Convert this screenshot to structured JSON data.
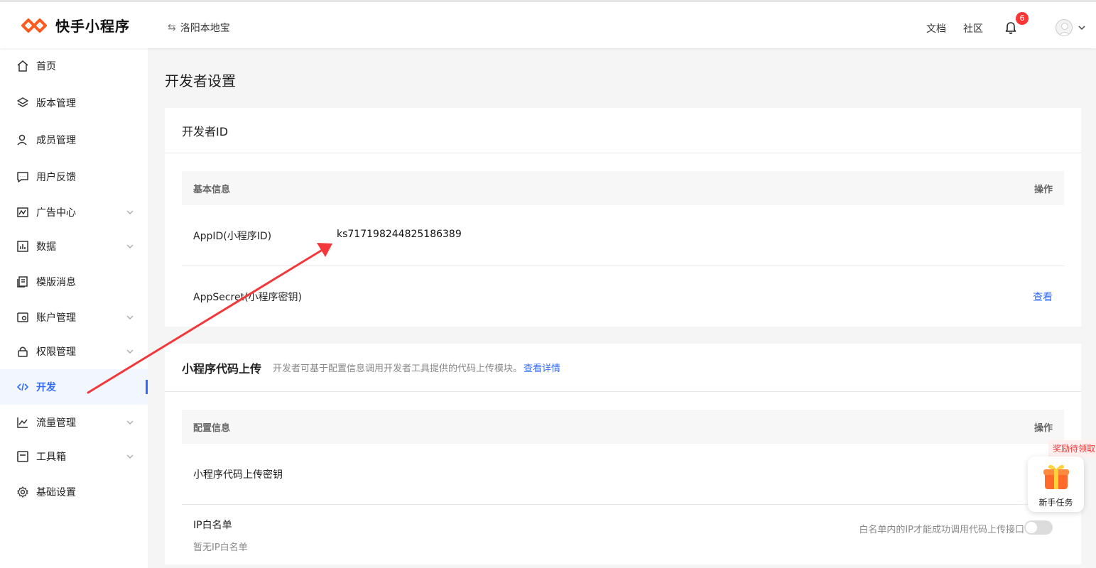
{
  "header": {
    "logo_text": "快手小程序",
    "app_name": "洛阳本地宝",
    "links": [
      "文档",
      "社区"
    ],
    "notification_count": "6"
  },
  "sidebar": {
    "items": [
      {
        "label": "首页",
        "icon": "home-icon",
        "has_chevron": false
      },
      {
        "label": "版本管理",
        "icon": "layers-icon",
        "has_chevron": false
      },
      {
        "label": "成员管理",
        "icon": "user-icon",
        "has_chevron": false
      },
      {
        "label": "用户反馈",
        "icon": "feedback-icon",
        "has_chevron": false
      },
      {
        "label": "广告中心",
        "icon": "ad-icon",
        "has_chevron": true
      },
      {
        "label": "数据",
        "icon": "chart-icon",
        "has_chevron": true
      },
      {
        "label": "模版消息",
        "icon": "template-icon",
        "has_chevron": false
      },
      {
        "label": "账户管理",
        "icon": "account-icon",
        "has_chevron": true
      },
      {
        "label": "权限管理",
        "icon": "lock-icon",
        "has_chevron": true
      },
      {
        "label": "开发",
        "icon": "code-icon",
        "has_chevron": false,
        "active": true
      },
      {
        "label": "流量管理",
        "icon": "trend-icon",
        "has_chevron": true
      },
      {
        "label": "工具箱",
        "icon": "toolbox-icon",
        "has_chevron": true
      },
      {
        "label": "基础设置",
        "icon": "gear-icon",
        "has_chevron": false
      }
    ]
  },
  "main": {
    "page_title": "开发者设置",
    "developer_id": {
      "title": "开发者ID",
      "header_left": "基本信息",
      "header_right": "操作",
      "rows": [
        {
          "label": "AppID(小程序ID)",
          "value": "ks717198244825186389"
        },
        {
          "label": "AppSecret(小程序密钥)",
          "action": "查看"
        }
      ]
    },
    "upload": {
      "title": "小程序代码上传",
      "desc": "开发者可基于配置信息调用开发者工具提供的代码上传模块。",
      "desc_link": "查看详情",
      "header_left": "配置信息",
      "header_right": "操作",
      "key_label": "小程序代码上传密钥",
      "whitelist_label": "IP白名单",
      "whitelist_empty": "暂无IP白名单",
      "whitelist_note": "白名单内的IP才能成功调用代码上传接口",
      "whitelist_enabled": false
    }
  },
  "reward": {
    "tag": "奖励待领取",
    "label": "新手任务"
  },
  "colors": {
    "accent": "#326bfb",
    "logo": "#fe3535",
    "badge": "#fe3535"
  }
}
